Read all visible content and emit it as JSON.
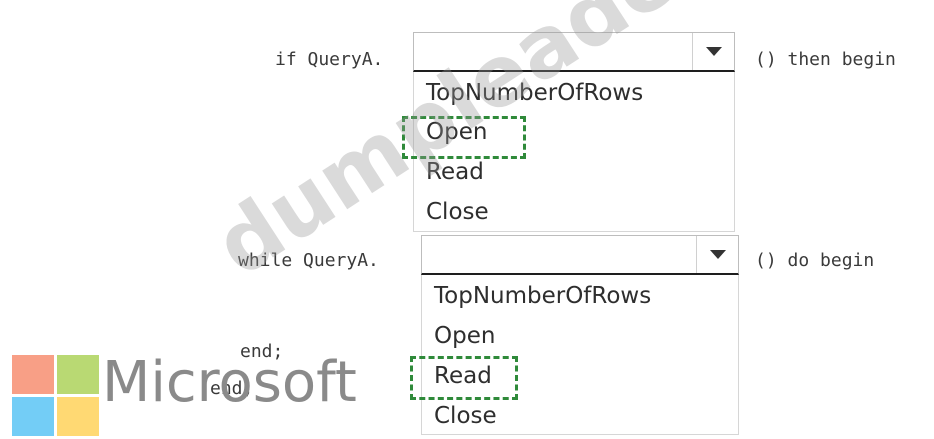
{
  "code": {
    "if_prefix": "if QueryA.",
    "if_suffix": "() then begin",
    "while_prefix": "while QueryA.",
    "while_suffix": "() do begin",
    "end_inner": "end;",
    "end_outer": "end;"
  },
  "dropdown_1": {
    "value": "",
    "options": [
      "TopNumberOfRows",
      "Open",
      "Read",
      "Close"
    ],
    "highlighted": "Open"
  },
  "dropdown_2": {
    "value": "",
    "options": [
      "TopNumberOfRows",
      "Open",
      "Read",
      "Close"
    ],
    "highlighted": "Read"
  },
  "watermark": "dumpleader.com",
  "logo": {
    "text": "Microsoft",
    "colors": [
      "#f25022",
      "#7fba00",
      "#00a4ef",
      "#ffb900"
    ]
  }
}
